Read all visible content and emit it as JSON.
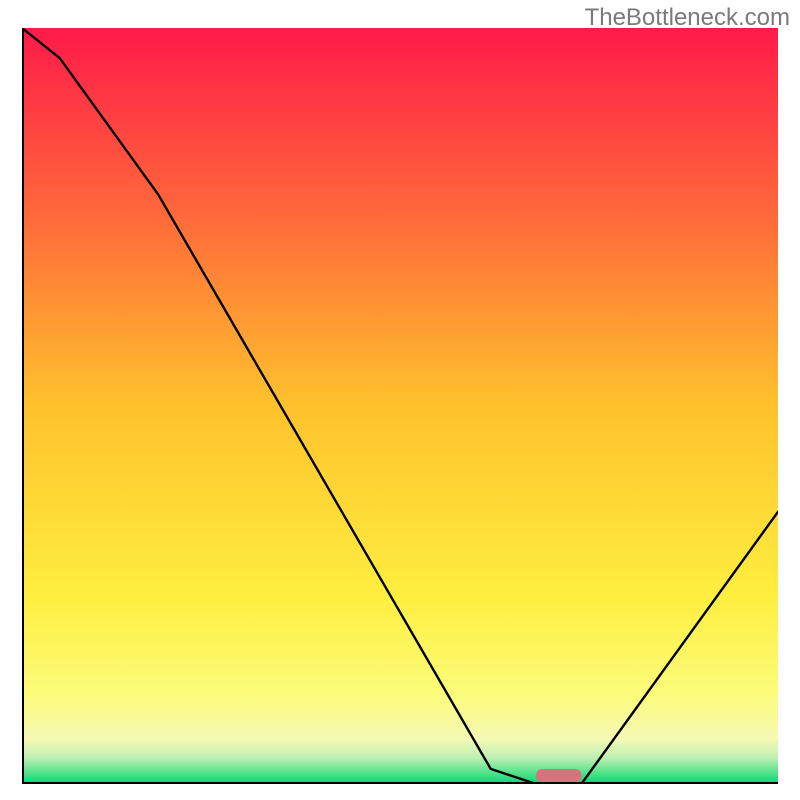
{
  "watermark": "TheBottleneck.com",
  "chart_data": {
    "type": "line",
    "title": "",
    "xlabel": "",
    "ylabel": "",
    "xlim": [
      0,
      100
    ],
    "ylim": [
      0,
      100
    ],
    "x": [
      0,
      5,
      18,
      62,
      68,
      74,
      100
    ],
    "values": [
      100,
      96,
      78,
      2,
      0,
      0,
      36
    ],
    "marker": {
      "x": 71,
      "y": 0,
      "width": 6,
      "height": 2,
      "color": "#d9727c"
    },
    "background_gradient": [
      {
        "pos": 0.0,
        "color": "#ff1a49"
      },
      {
        "pos": 0.25,
        "color": "#ff6a3a"
      },
      {
        "pos": 0.5,
        "color": "#ffc22c"
      },
      {
        "pos": 0.75,
        "color": "#feee3f"
      },
      {
        "pos": 0.88,
        "color": "#fcfc7a"
      },
      {
        "pos": 0.94,
        "color": "#f6f9b4"
      },
      {
        "pos": 0.965,
        "color": "#bff0b4"
      },
      {
        "pos": 0.985,
        "color": "#53e28a"
      },
      {
        "pos": 1.0,
        "color": "#00d877"
      }
    ],
    "axes_color": "#000000",
    "line_color": "#000000"
  }
}
